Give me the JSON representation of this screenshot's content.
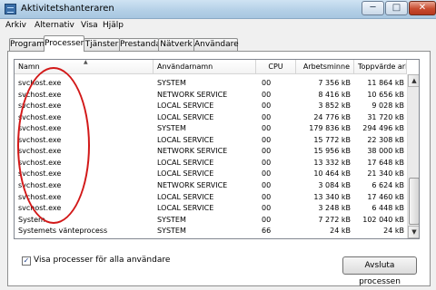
{
  "window": {
    "title": "Aktivitetshanteraren",
    "minimize_glyph": "─",
    "maximize_glyph": "□",
    "close_glyph": "✕"
  },
  "menu": [
    "Arkiv",
    "Alternativ",
    "Visa",
    "Hjälp"
  ],
  "tabs": [
    "Program",
    "Processer",
    "Tjänster",
    "Prestanda",
    "Nätverk",
    "Användare"
  ],
  "active_tab": "Processer",
  "table": {
    "columns": [
      "Namn",
      "Användarnamn",
      "CPU",
      "Arbetsminne",
      "Toppvärde arb..."
    ],
    "sort_column": "Namn",
    "rows": [
      [
        "svchost.exe",
        "SYSTEM",
        "00",
        "7 356 kB",
        "11 864 kB"
      ],
      [
        "svchost.exe",
        "NETWORK SERVICE",
        "00",
        "8 416 kB",
        "10 656 kB"
      ],
      [
        "svchost.exe",
        "LOCAL SERVICE",
        "00",
        "3 852 kB",
        "9 028 kB"
      ],
      [
        "svchost.exe",
        "LOCAL SERVICE",
        "00",
        "24 776 kB",
        "31 720 kB"
      ],
      [
        "svchost.exe",
        "SYSTEM",
        "00",
        "179 836 kB",
        "294 496 kB"
      ],
      [
        "svchost.exe",
        "LOCAL SERVICE",
        "00",
        "15 772 kB",
        "22 308 kB"
      ],
      [
        "svchost.exe",
        "NETWORK SERVICE",
        "00",
        "15 956 kB",
        "38 000 kB"
      ],
      [
        "svchost.exe",
        "LOCAL SERVICE",
        "00",
        "13 332 kB",
        "17 648 kB"
      ],
      [
        "svchost.exe",
        "LOCAL SERVICE",
        "00",
        "10 464 kB",
        "21 340 kB"
      ],
      [
        "svchost.exe",
        "NETWORK SERVICE",
        "00",
        "3 084 kB",
        "6 624 kB"
      ],
      [
        "svchost.exe",
        "LOCAL SERVICE",
        "00",
        "13 340 kB",
        "17 460 kB"
      ],
      [
        "svchost.exe",
        "LOCAL SERVICE",
        "00",
        "3 248 kB",
        "6 448 kB"
      ],
      [
        "System",
        "SYSTEM",
        "00",
        "7 272 kB",
        "102 040 kB"
      ],
      [
        "Systemets vänteprocess",
        "SYSTEM",
        "66",
        "24 kB",
        "24 kB"
      ]
    ]
  },
  "show_all_processes": {
    "label": "Visa processer för alla användare",
    "checked": true,
    "check_glyph": "✓"
  },
  "end_process_button": "Avsluta processen",
  "scrollbar": {
    "up_glyph": "▲",
    "down_glyph": "▼"
  },
  "annotation_color": "#d21818"
}
